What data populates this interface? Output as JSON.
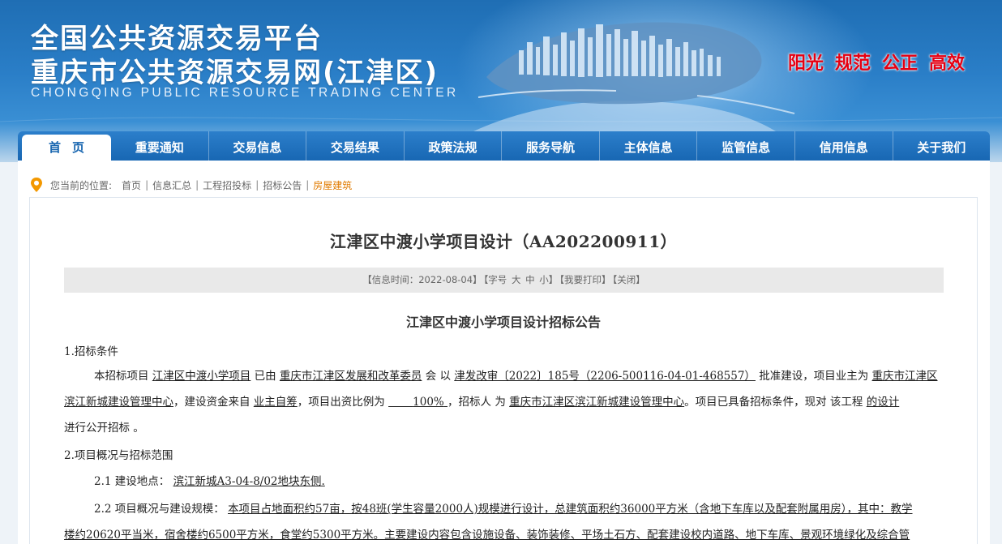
{
  "header": {
    "title_line1": "全国公共资源交易平台",
    "title_line2": "重庆市公共资源交易网(江津区)",
    "title_en": "CHONGQING PUBLIC RESOURCE TRADING CENTER",
    "slogans": [
      "阳光",
      "规范",
      "公正",
      "高效"
    ]
  },
  "nav": {
    "items": [
      "首页",
      "重要通知",
      "交易信息",
      "交易结果",
      "政策法规",
      "服务导航",
      "主体信息",
      "监管信息",
      "信用信息",
      "关于我们"
    ]
  },
  "breadcrumb": {
    "label": "您当前的位置:",
    "items": [
      "首页",
      "信息汇总",
      "工程招投标",
      "招标公告",
      "房屋建筑"
    ]
  },
  "article": {
    "title": "江津区中渡小学项目设计（AA202200911）",
    "meta": {
      "time_label": "【信息时间：2022-08-04】",
      "font_label": "【字号",
      "font_large": "大",
      "font_mid": "中",
      "font_small": "小】",
      "print": "【我要打印】",
      "close": "【关闭】"
    },
    "notice_title": "江津区中渡小学项目设计招标公告",
    "section1_title": "1.招标条件",
    "p1": {
      "t1": "本招标项目",
      "project": "江津区中渡小学项目",
      "t2": "已由",
      "approver": "重庆市江津区发展和改革委员",
      "t3": "会 以",
      "doc": "津发改审〔2022〕185号（2206-500116-04-01-468557）",
      "t4": "批准建设，项目业主为",
      "owner": "重庆市江津区滨江新城建设管理中心",
      "t5": "，建设资金来自",
      "fund": "业主自筹",
      "t6": "，项目出资比例为",
      "ratio": "100%",
      "t7": "，招标人 为",
      "tenderer": "重庆市江津区滨江新城建设管理中心",
      "t8": "。项目已具备招标条件，现对 该工程",
      "scope": "的设计",
      "t9": "进行公开招标 。"
    },
    "section2_title": "2.项目概况与招标范围",
    "s21_label": "2.1 建设地点：",
    "s21_value": "滨江新城A3-04-8/02地块东侧.",
    "s22_label": "2.2 项目概况与建设规模：",
    "s22_value": "本项目占地面积约57亩，按48班(学生容量2000人)规模进行设计，总建筑面积约36000平方米（含地下车库以及配套附属用房），其中：教学",
    "s22_cont": "楼约20620平当米，宿舍楼约6500平方米，食堂约5300平方米。主要建设内容包含设施设备、装饰装修、平场土石方、配套建设校内道路、地下车库、景观环境绿化及综合管"
  }
}
